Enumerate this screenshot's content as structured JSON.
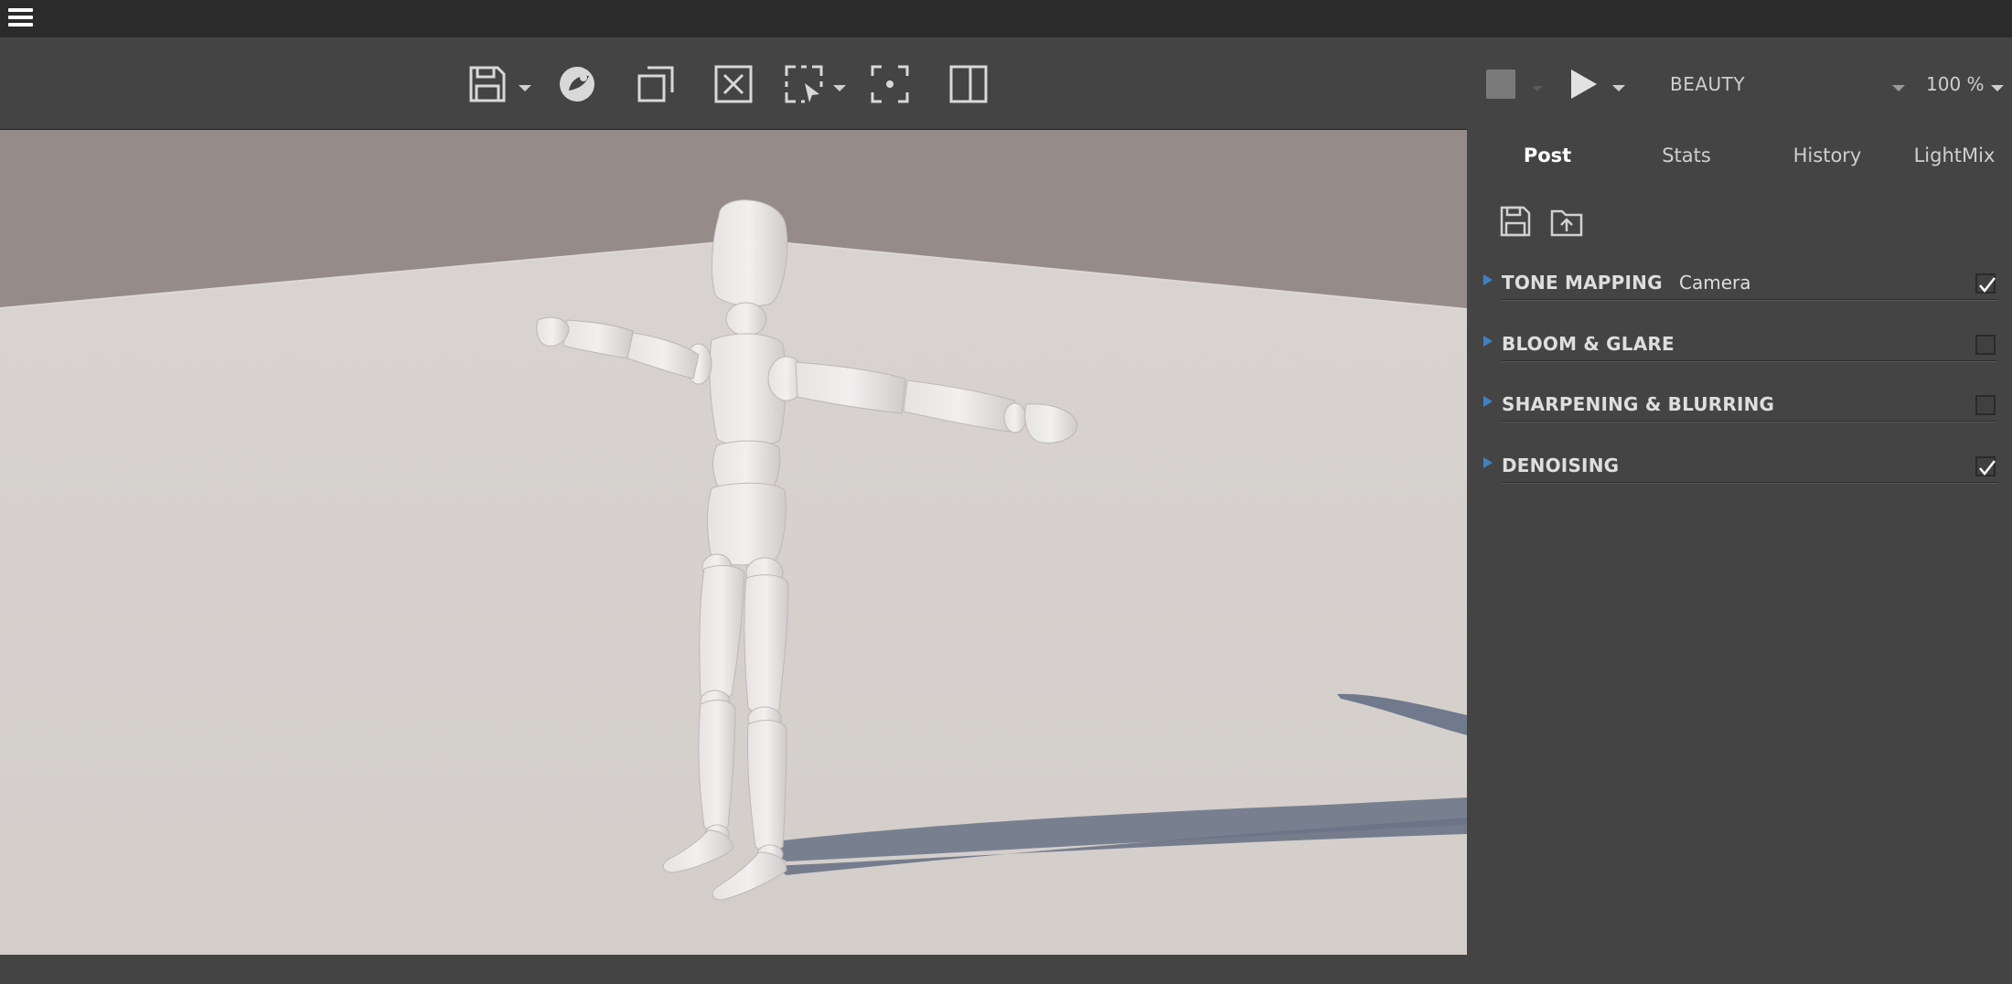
{
  "titlebar": {
    "menu_icon": "hamburger-menu-icon"
  },
  "toolbar": {
    "left_tools": [
      {
        "name": "save-icon",
        "has_dropdown": true
      },
      {
        "name": "cinema4d-logo-icon",
        "has_dropdown": false
      },
      {
        "name": "duplicate-icon",
        "has_dropdown": false
      },
      {
        "name": "close-image-icon",
        "has_dropdown": false
      },
      {
        "name": "region-select-icon",
        "has_dropdown": true
      },
      {
        "name": "focus-pick-icon",
        "has_dropdown": false
      },
      {
        "name": "split-view-icon",
        "has_dropdown": false
      }
    ],
    "render_pass": "BEAUTY",
    "zoom": "100 %"
  },
  "panel": {
    "tabs": [
      {
        "label": "Post",
        "active": true
      },
      {
        "label": "Stats",
        "active": false
      },
      {
        "label": "History",
        "active": false
      },
      {
        "label": "LightMix",
        "active": false
      }
    ],
    "sections": [
      {
        "title": "TONE MAPPING",
        "value": "Camera",
        "checked": true
      },
      {
        "title": "BLOOM & GLARE",
        "value": "",
        "checked": false
      },
      {
        "title": "SHARPENING & BLURRING",
        "value": "",
        "checked": false
      },
      {
        "title": "DENOISING",
        "value": "",
        "checked": true
      }
    ]
  },
  "colors": {
    "background": "#444444",
    "titlebar": "#2b2b2b",
    "accent": "#3d82c4",
    "floor": "#d6d1cf",
    "wall": "#958b88",
    "shadow": "#6f7888"
  }
}
